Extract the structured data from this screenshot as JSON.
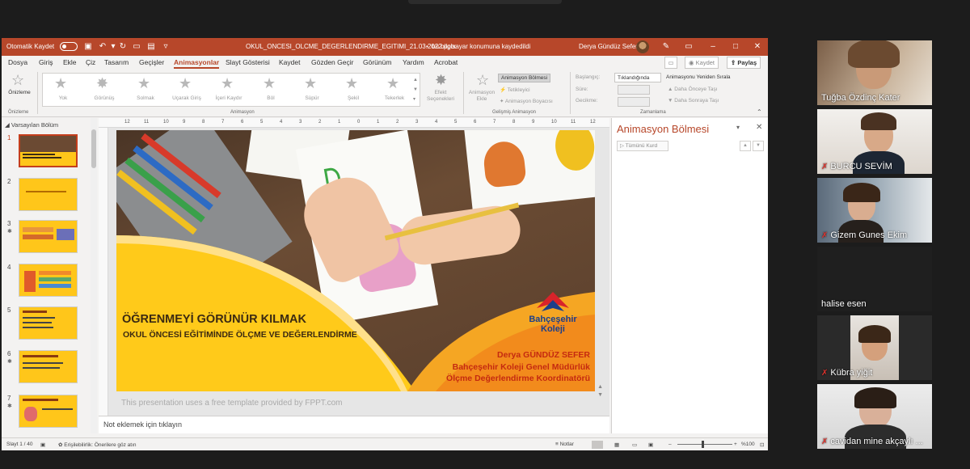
{
  "app": {
    "autosave_label": "Otomatik Kaydet",
    "file_title": "OKUL_ONCESI_OLCME_DEGERLENDIRME_EGITIMI_21.03.2022.pptx",
    "save_status": "bu bilgisayar konumuna kaydedildi",
    "user_name": "Derya Gündüz Sefer",
    "accent_color": "#b7472a"
  },
  "menu": {
    "tabs": [
      "Dosya",
      "Giriş",
      "Ekle",
      "Çiz",
      "Tasarım",
      "Geçişler",
      "Animasyonlar",
      "Slayt Gösterisi",
      "Kaydet",
      "Gözden Geçir",
      "Görünüm",
      "Yardım",
      "Acrobat"
    ],
    "active_tab": "Animasyonlar",
    "record_label": "Kaydet",
    "share_label": "Paylaş"
  },
  "ribbon": {
    "preview_label": "Önizleme",
    "preview_group": "Önizleme",
    "animations": [
      "Yok",
      "Görünüş",
      "Solmak",
      "Uçarak Giriş",
      "İçeri Kaydır",
      "Böl",
      "Süpür",
      "Şekil",
      "Tekerlek"
    ],
    "effect_options": "Efekt Seçenekleri",
    "animation_group": "Animasyon",
    "add_animation": "Animasyon Ekle",
    "anim_pane_btn": "Animasyon Bölmesi",
    "trigger_btn": "Tetikleyici",
    "anim_painter": "Animasyon Boyacısı",
    "advanced_group": "Gelişmiş Animasyon",
    "start_label": "Başlangıç:",
    "start_value": "Tıklandığında",
    "duration_label": "Süre:",
    "delay_label": "Gecikme:",
    "reorder_title": "Animasyonu Yeniden Sırala",
    "move_earlier": "Daha Önceye Taşı",
    "move_later": "Daha Sonraya Taşı",
    "timing_group": "Zamanlama"
  },
  "thumbnails": {
    "section_label": "Varsayılan Bölüm",
    "slides": [
      "1",
      "2",
      "3",
      "4",
      "5",
      "6",
      "7"
    ]
  },
  "slide": {
    "title": "ÖĞRENMEYİ GÖRÜNÜR KILMAK",
    "subtitle": "OKUL ÖNCESİ EĞİTİMİNDE ÖLÇME VE DEĞERLENDİRME",
    "logo_line1": "Bahçeşehir",
    "logo_line2": "Koleji",
    "author": "Derya GÜNDÜZ SEFER",
    "role1": "Bahçeşehir Koleji Genel Müdürlük",
    "role2": "Ölçme Değerlendirme Koordinatörü",
    "template_note": "This presentation uses a free template provided by FPPT.com"
  },
  "ruler_ticks": [
    "12",
    "11",
    "10",
    "9",
    "8",
    "7",
    "6",
    "5",
    "4",
    "3",
    "2",
    "1",
    "0",
    "1",
    "2",
    "3",
    "4",
    "5",
    "6",
    "7",
    "8",
    "9",
    "10",
    "11",
    "12"
  ],
  "notes_placeholder": "Not eklemek için tıklayın",
  "anim_pane": {
    "title": "Animasyon Bölmesi",
    "play_label": "Tümünü Kurd"
  },
  "status": {
    "slide_info": "Slayt 1 / 40",
    "accessibility": "Erişilebilirlik: Önerilere göz atın",
    "notes": "Notlar",
    "zoom": "%100"
  },
  "participants": [
    {
      "name": "Tuğba Özdinç Kater",
      "muted": false
    },
    {
      "name": "BURCU SEVİM",
      "muted": true
    },
    {
      "name": "Gizem Gunes Ekim",
      "muted": true
    },
    {
      "name": "halise esen",
      "muted": false
    },
    {
      "name": "Kübra yiğit",
      "muted": true
    },
    {
      "name": "cavidan mine akçaylı ...",
      "muted": true
    }
  ]
}
